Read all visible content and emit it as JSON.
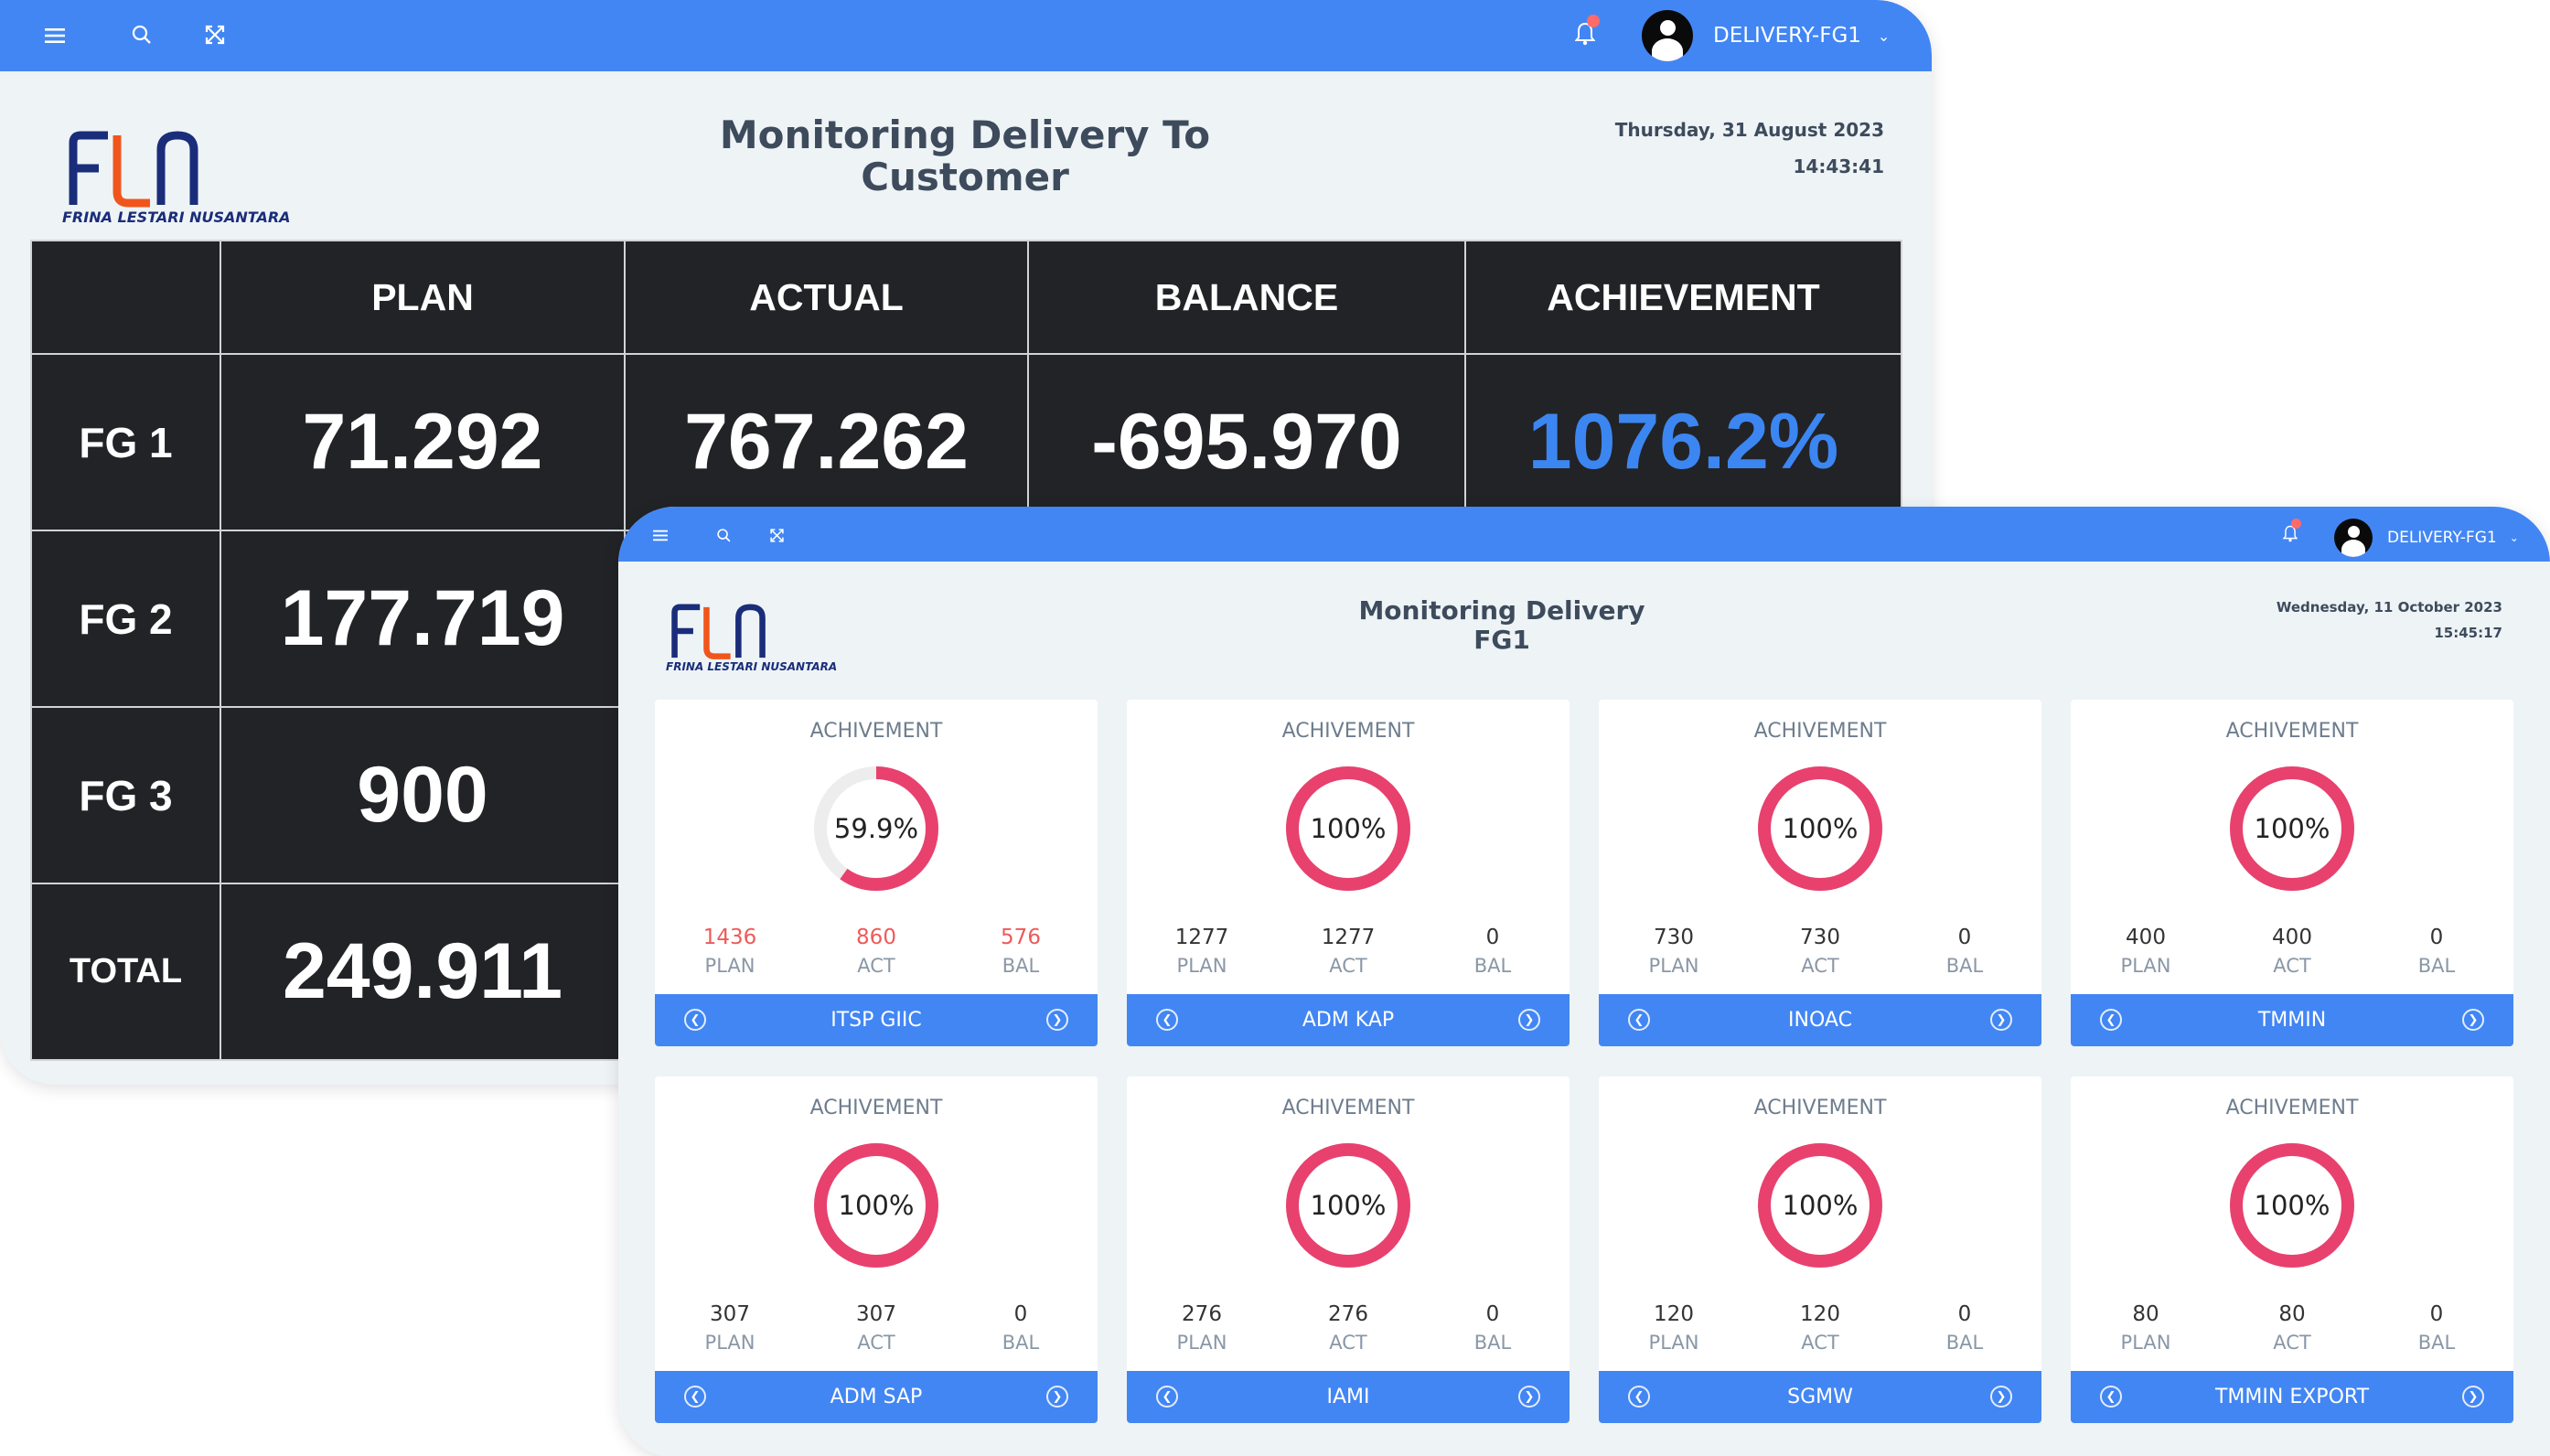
{
  "window1": {
    "topbar": {
      "user_name": "DELIVERY-FG1",
      "menu_icon": "menu-icon",
      "search_icon": "search-icon",
      "expand_icon": "fullscreen-icon",
      "bell_icon": "bell-icon"
    },
    "logo": {
      "mark": "FLN",
      "tagline": "FRINA LESTARI NUSANTARA"
    },
    "title": "Monitoring Delivery To Customer",
    "date": "Thursday, 31 August 2023",
    "time": "14:43:41",
    "table": {
      "headers": [
        "",
        "PLAN",
        "ACTUAL",
        "BALANCE",
        "ACHIEVEMENT"
      ],
      "rows": [
        {
          "label": "FG 1",
          "plan": "71.292",
          "actual": "767.262",
          "balance": "-695.970",
          "achievement": "1076.2%"
        },
        {
          "label": "FG 2",
          "plan": "177.719"
        },
        {
          "label": "FG 3",
          "plan": "900"
        },
        {
          "label": "TOTAL",
          "plan": "249.911"
        }
      ]
    }
  },
  "window2": {
    "topbar": {
      "user_name": "DELIVERY-FG1"
    },
    "logo": {
      "mark": "FLN",
      "tagline": "FRINA LESTARI NUSANTARA"
    },
    "title_line1": "Monitoring Delivery",
    "title_line2": "FG1",
    "date": "Wednesday, 11 October 2023",
    "time": "15:45:17",
    "colors": {
      "accent": "#4286f4",
      "donut": "#e8416e",
      "donut_track": "#ededed",
      "shortfall": "#ee5a5a"
    },
    "cards": [
      {
        "title": "ACHIVEMENT",
        "percent_label": "59.9%",
        "fill": 0.599,
        "plan": "1436",
        "act": "860",
        "bal": "576",
        "plan_label": "PLAN",
        "act_label": "ACT",
        "bal_label": "BAL",
        "name": "ITSP GIIC",
        "shortfall": true
      },
      {
        "title": "ACHIVEMENT",
        "percent_label": "100%",
        "fill": 1,
        "plan": "1277",
        "act": "1277",
        "bal": "0",
        "plan_label": "PLAN",
        "act_label": "ACT",
        "bal_label": "BAL",
        "name": "ADM KAP",
        "shortfall": false
      },
      {
        "title": "ACHIVEMENT",
        "percent_label": "100%",
        "fill": 1,
        "plan": "730",
        "act": "730",
        "bal": "0",
        "plan_label": "PLAN",
        "act_label": "ACT",
        "bal_label": "BAL",
        "name": "INOAC",
        "shortfall": false
      },
      {
        "title": "ACHIVEMENT",
        "percent_label": "100%",
        "fill": 1,
        "plan": "400",
        "act": "400",
        "bal": "0",
        "plan_label": "PLAN",
        "act_label": "ACT",
        "bal_label": "BAL",
        "name": "TMMIN",
        "shortfall": false
      },
      {
        "title": "ACHIVEMENT",
        "percent_label": "100%",
        "fill": 1,
        "plan": "307",
        "act": "307",
        "bal": "0",
        "plan_label": "PLAN",
        "act_label": "ACT",
        "bal_label": "BAL",
        "name": "ADM SAP",
        "shortfall": false
      },
      {
        "title": "ACHIVEMENT",
        "percent_label": "100%",
        "fill": 1,
        "plan": "276",
        "act": "276",
        "bal": "0",
        "plan_label": "PLAN",
        "act_label": "ACT",
        "bal_label": "BAL",
        "name": "IAMI",
        "shortfall": false
      },
      {
        "title": "ACHIVEMENT",
        "percent_label": "100%",
        "fill": 1,
        "plan": "120",
        "act": "120",
        "bal": "0",
        "plan_label": "PLAN",
        "act_label": "ACT",
        "bal_label": "BAL",
        "name": "SGMW",
        "shortfall": false
      },
      {
        "title": "ACHIVEMENT",
        "percent_label": "100%",
        "fill": 1,
        "plan": "80",
        "act": "80",
        "bal": "0",
        "plan_label": "PLAN",
        "act_label": "ACT",
        "bal_label": "BAL",
        "name": "TMMIN EXPORT",
        "shortfall": false
      }
    ]
  }
}
